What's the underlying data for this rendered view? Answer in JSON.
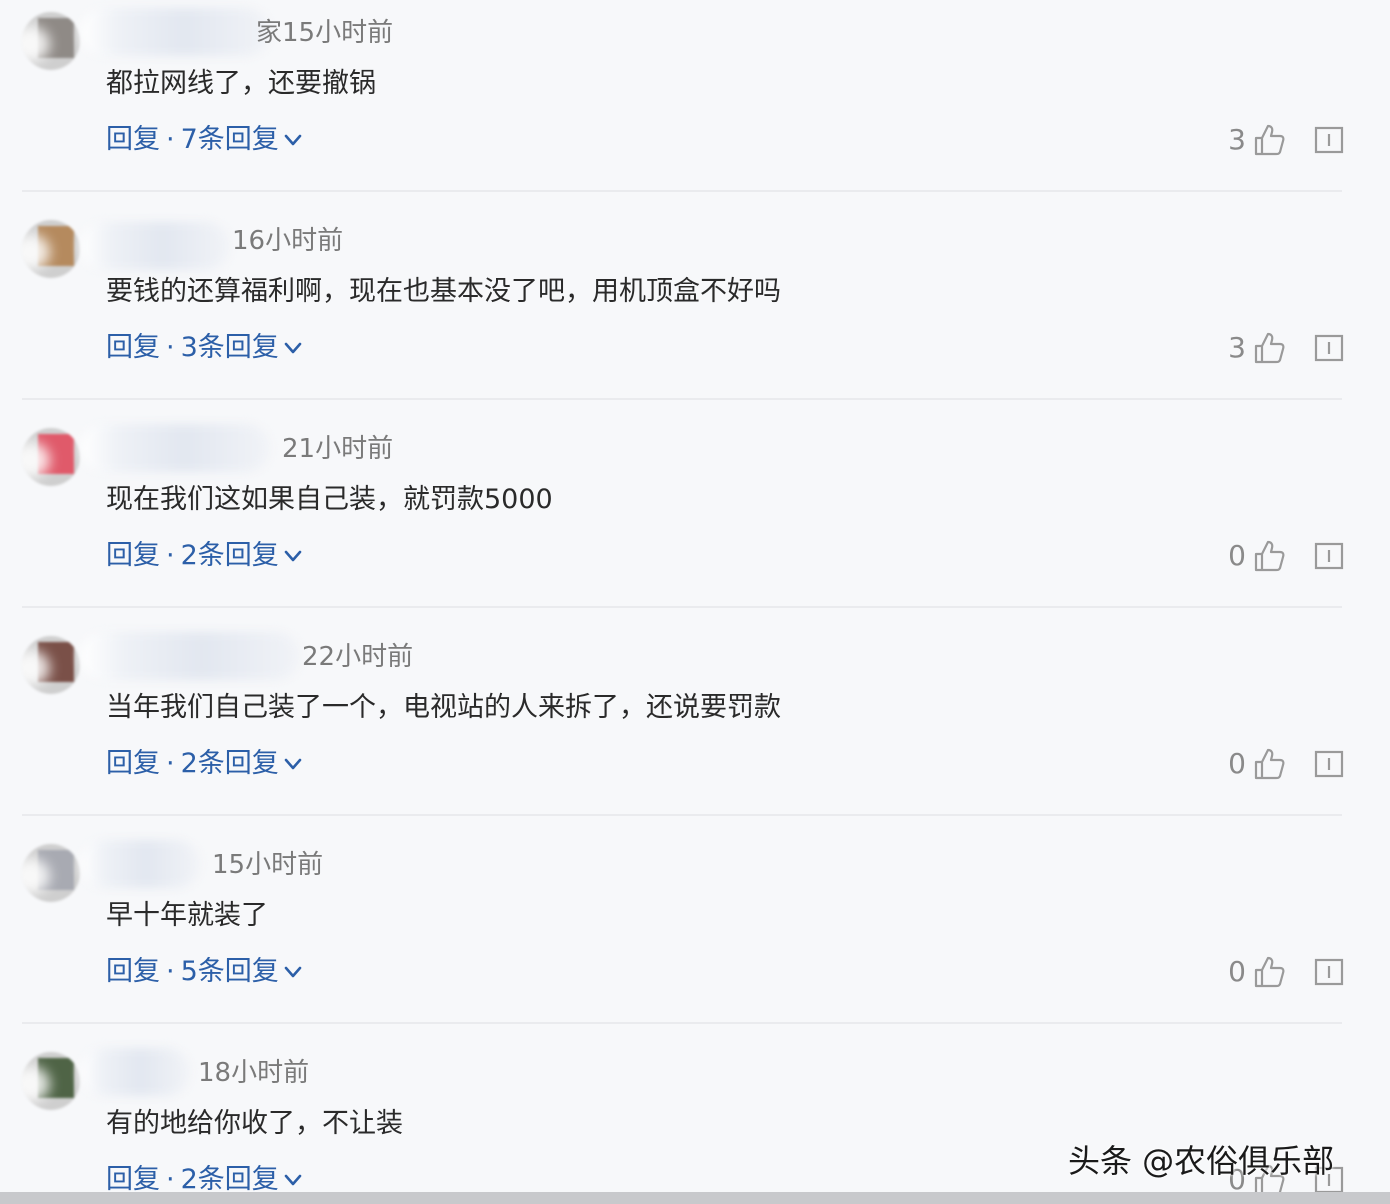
{
  "colors": {
    "background": "#f7f8fa",
    "link": "#2c5fa8",
    "text": "#2a2a2a",
    "meta": "#7a7a7a"
  },
  "comments": [
    {
      "name_fragment": "家",
      "time": "15小时前",
      "text": "都拉网线了，还要撤锅",
      "reply_label": "回复",
      "reply_count_label": "7条回复",
      "likes": "3",
      "avatar_color": "#8f8a86"
    },
    {
      "name_fragment": "",
      "time": "16小时前",
      "text": "要钱的还算福利啊，现在也基本没了吧，用机顶盒不好吗",
      "reply_label": "回复",
      "reply_count_label": "3条回复",
      "likes": "3",
      "avatar_color": "#b58a5e"
    },
    {
      "name_fragment": "",
      "time": "21小时前",
      "text": "现在我们这如果自己装，就罚款5000",
      "reply_label": "回复",
      "reply_count_label": "2条回复",
      "likes": "0",
      "avatar_color": "#e05a6a"
    },
    {
      "name_fragment": "",
      "time": "22小时前",
      "text": "当年我们自己装了一个，电视站的人来拆了，还说要罚款",
      "reply_label": "回复",
      "reply_count_label": "2条回复",
      "likes": "0",
      "avatar_color": "#7a5048"
    },
    {
      "name_fragment": "",
      "time": "15小时前",
      "text": "早十年就装了",
      "reply_label": "回复",
      "reply_count_label": "5条回复",
      "likes": "0",
      "avatar_color": "#a8aab2"
    },
    {
      "name_fragment": "",
      "time": "18小时前",
      "text": "有的地给你收了，不让装",
      "reply_label": "回复",
      "reply_count_label": "2条回复",
      "likes": "0",
      "avatar_color": "#4f6446"
    }
  ],
  "watermark": "头条 @农俗俱乐部",
  "icons": {
    "like": "thumbs-up-icon",
    "report": "report-icon",
    "expand": "chevron-down-icon"
  }
}
